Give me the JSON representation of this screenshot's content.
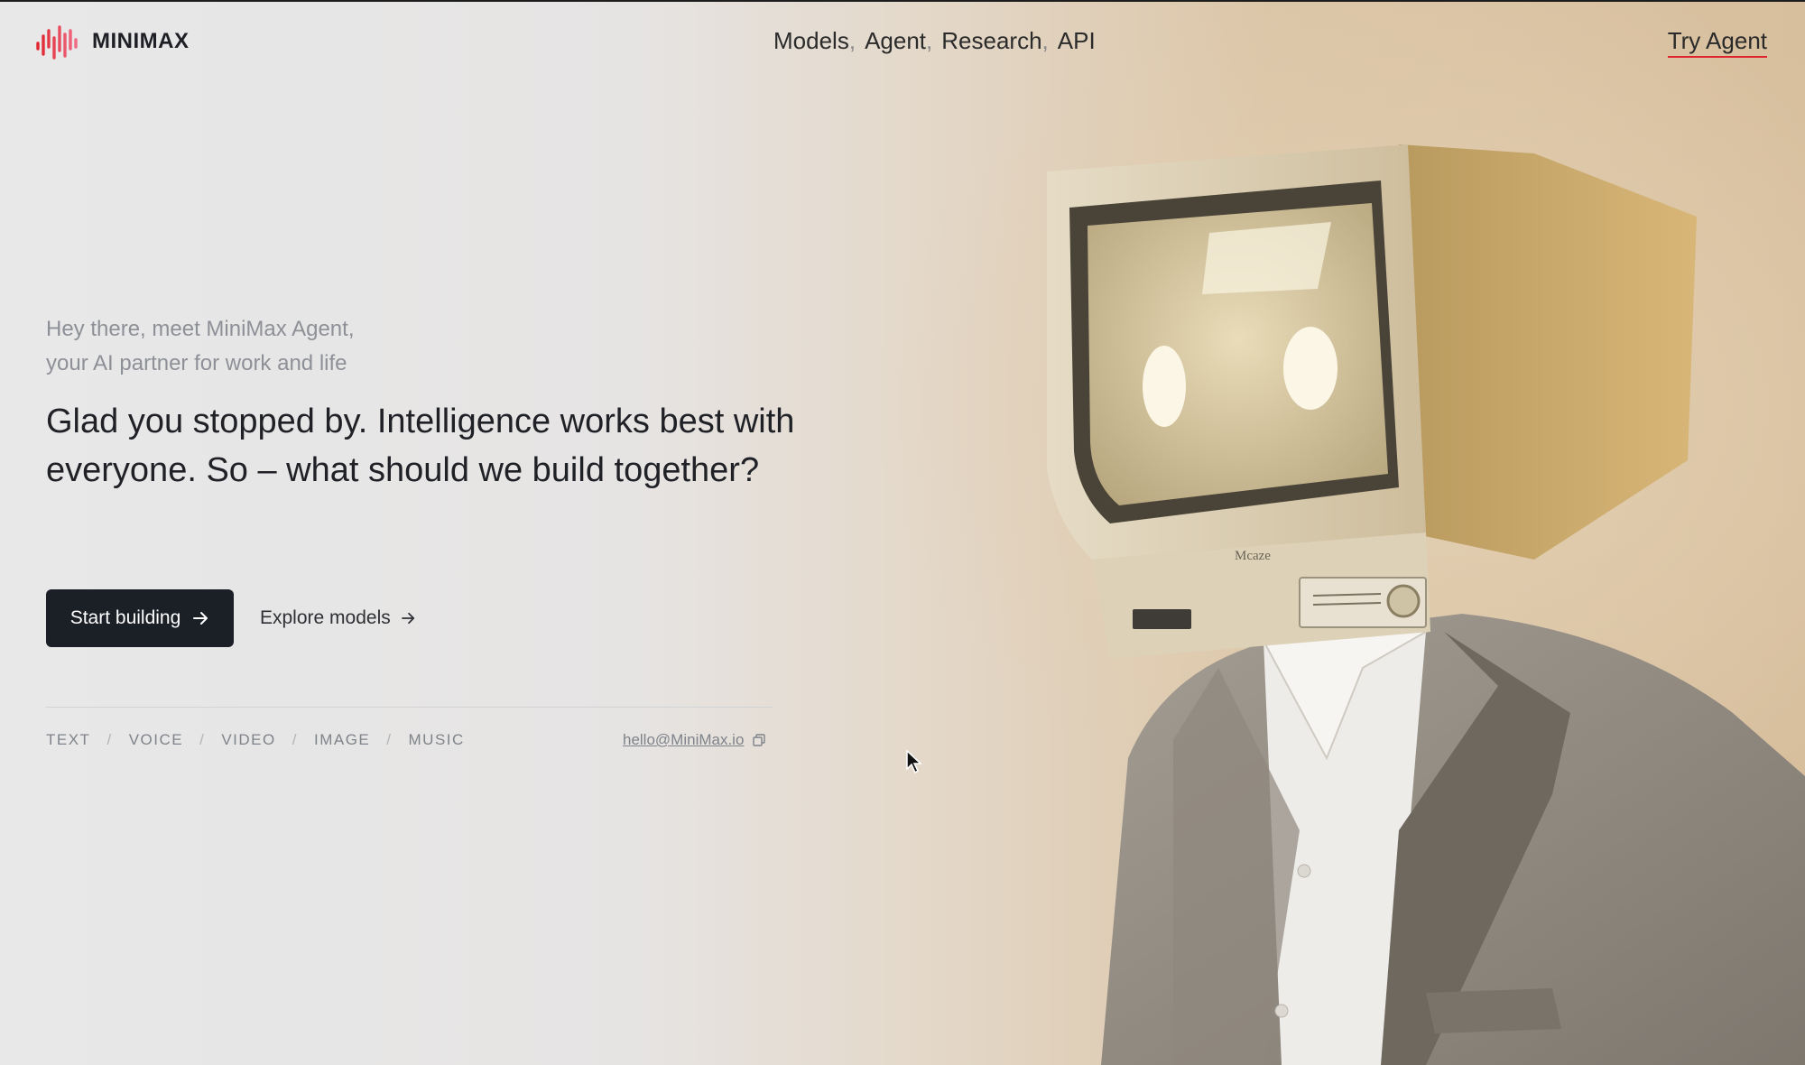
{
  "header": {
    "brand": "MINIMAX",
    "nav": [
      {
        "label": "Models",
        "sep": ","
      },
      {
        "label": "Agent",
        "sep": ","
      },
      {
        "label": "Research",
        "sep": ","
      },
      {
        "label": "API",
        "sep": ""
      }
    ],
    "try_label": "Try Agent"
  },
  "hero": {
    "intro_line1": "Hey there, meet MiniMax Agent,",
    "intro_line2": "your AI partner for work and life",
    "headline": "Glad you stopped by. Intelligence works best with everyone. So – what should we build together?",
    "primary_cta": "Start building",
    "secondary_cta": "Explore models",
    "modalities": [
      "TEXT",
      "VOICE",
      "VIDEO",
      "IMAGE",
      "MUSIC"
    ],
    "email": "hello@MiniMax.io"
  },
  "illustration": {
    "monitor_label": "Mcaze"
  },
  "colors": {
    "accent": "#e0242e",
    "dark": "#1b1f26"
  }
}
